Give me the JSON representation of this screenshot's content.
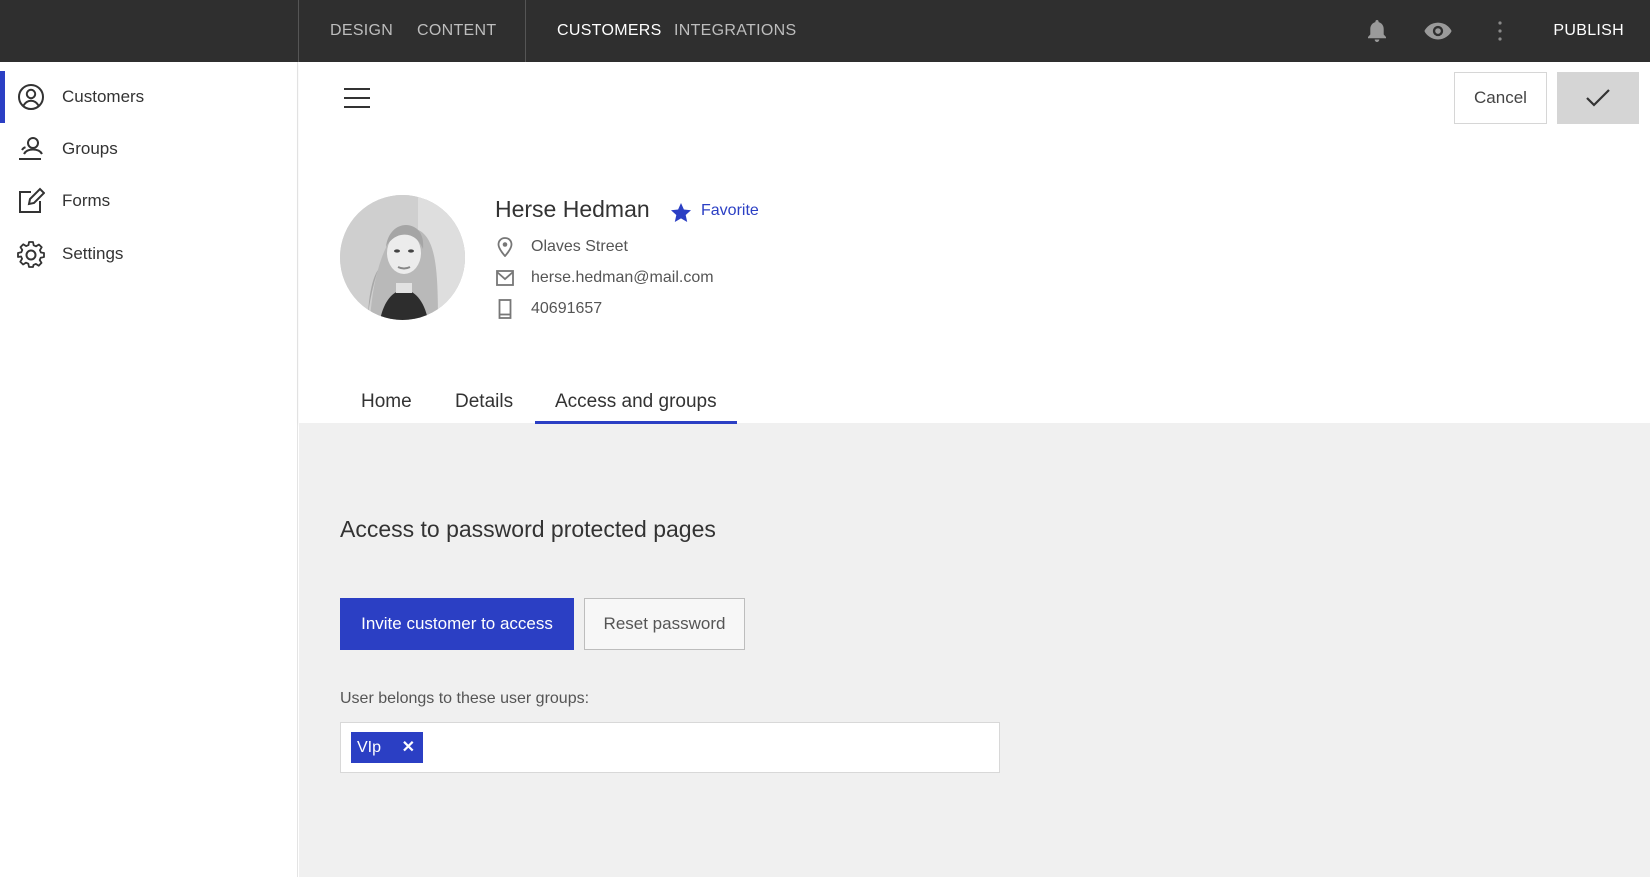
{
  "topbar": {
    "nav_left": [
      "DESIGN",
      "CONTENT"
    ],
    "nav_mid": [
      "CUSTOMERS",
      "INTEGRATIONS"
    ],
    "active_nav": "CUSTOMERS",
    "publish_label": "PUBLISH",
    "icons": [
      "bell-icon",
      "eye-icon",
      "more-vertical-icon"
    ]
  },
  "sidebar": {
    "items": [
      {
        "label": "Customers",
        "icon": "user-circle-icon",
        "active": true
      },
      {
        "label": "Groups",
        "icon": "users-icon",
        "active": false
      },
      {
        "label": "Forms",
        "icon": "edit-form-icon",
        "active": false
      },
      {
        "label": "Settings",
        "icon": "gear-icon",
        "active": false
      }
    ]
  },
  "toolbar": {
    "cancel_label": "Cancel",
    "confirm_icon": "check-icon"
  },
  "profile": {
    "name": "Herse Hedman",
    "favorite_label": "Favorite",
    "address": "Olaves Street",
    "email": "herse.hedman@mail.com",
    "phone": "40691657"
  },
  "tabs": [
    {
      "label": "Home",
      "active": false
    },
    {
      "label": "Details",
      "active": false
    },
    {
      "label": "Access and groups",
      "active": true
    }
  ],
  "access": {
    "title": "Access to password protected pages",
    "invite_label": "Invite customer to access",
    "reset_label": "Reset password",
    "groups_label": "User belongs to these user groups:",
    "groups": [
      "VIp"
    ]
  },
  "colors": {
    "accent": "#2b3fc4",
    "topbar_bg": "#2f2f2f",
    "content_bg": "#f0f0f0"
  }
}
